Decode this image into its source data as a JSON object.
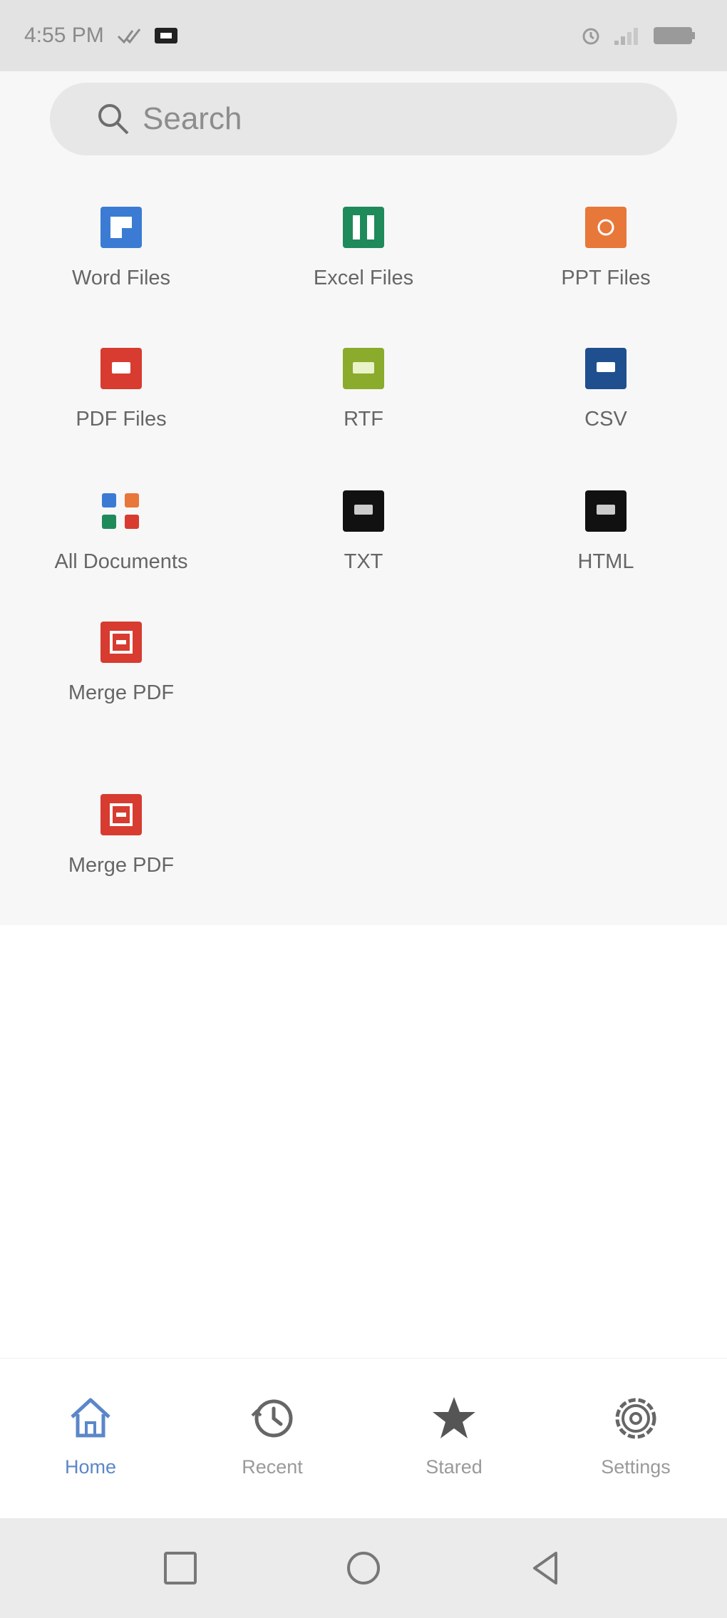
{
  "status_bar": {
    "time": "4:55 PM"
  },
  "search": {
    "placeholder": "Search"
  },
  "tiles": [
    {
      "label": "Word Files",
      "icon": "word-file-icon",
      "color": "#3b7bd4"
    },
    {
      "label": "Excel Files",
      "icon": "excel-file-icon",
      "color": "#1f8a5a"
    },
    {
      "label": "PPT Files",
      "icon": "ppt-file-icon",
      "color": "#e8773a"
    },
    {
      "label": "PDF Files",
      "icon": "pdf-file-icon",
      "color": "#d83b30"
    },
    {
      "label": "RTF",
      "icon": "rtf-file-icon",
      "color": "#8aab2b"
    },
    {
      "label": "CSV",
      "icon": "csv-file-icon",
      "color": "#1f4f8f"
    },
    {
      "label": "All Documents",
      "icon": "all-documents-icon",
      "color": "#3b7bd4"
    },
    {
      "label": "TXT",
      "icon": "txt-file-icon",
      "color": "#111111"
    },
    {
      "label": "HTML",
      "icon": "html-file-icon",
      "color": "#111111"
    },
    {
      "label": "Merge PDF",
      "icon": "merge-pdf-icon",
      "color": "#d83b30"
    },
    {
      "label": "Merge PDF",
      "icon": "merge-pdf-icon",
      "color": "#d83b30"
    }
  ],
  "bottom_nav": [
    {
      "label": "Home",
      "icon": "home-icon",
      "active": true
    },
    {
      "label": "Recent",
      "icon": "clock-icon",
      "active": false
    },
    {
      "label": "Stared",
      "icon": "star-icon",
      "active": false
    },
    {
      "label": "Settings",
      "icon": "gear-icon",
      "active": false
    }
  ],
  "colors": {
    "accent": "#5b87c9",
    "status_bar": "#e3e3e3",
    "content_bg": "#f7f7f7"
  }
}
